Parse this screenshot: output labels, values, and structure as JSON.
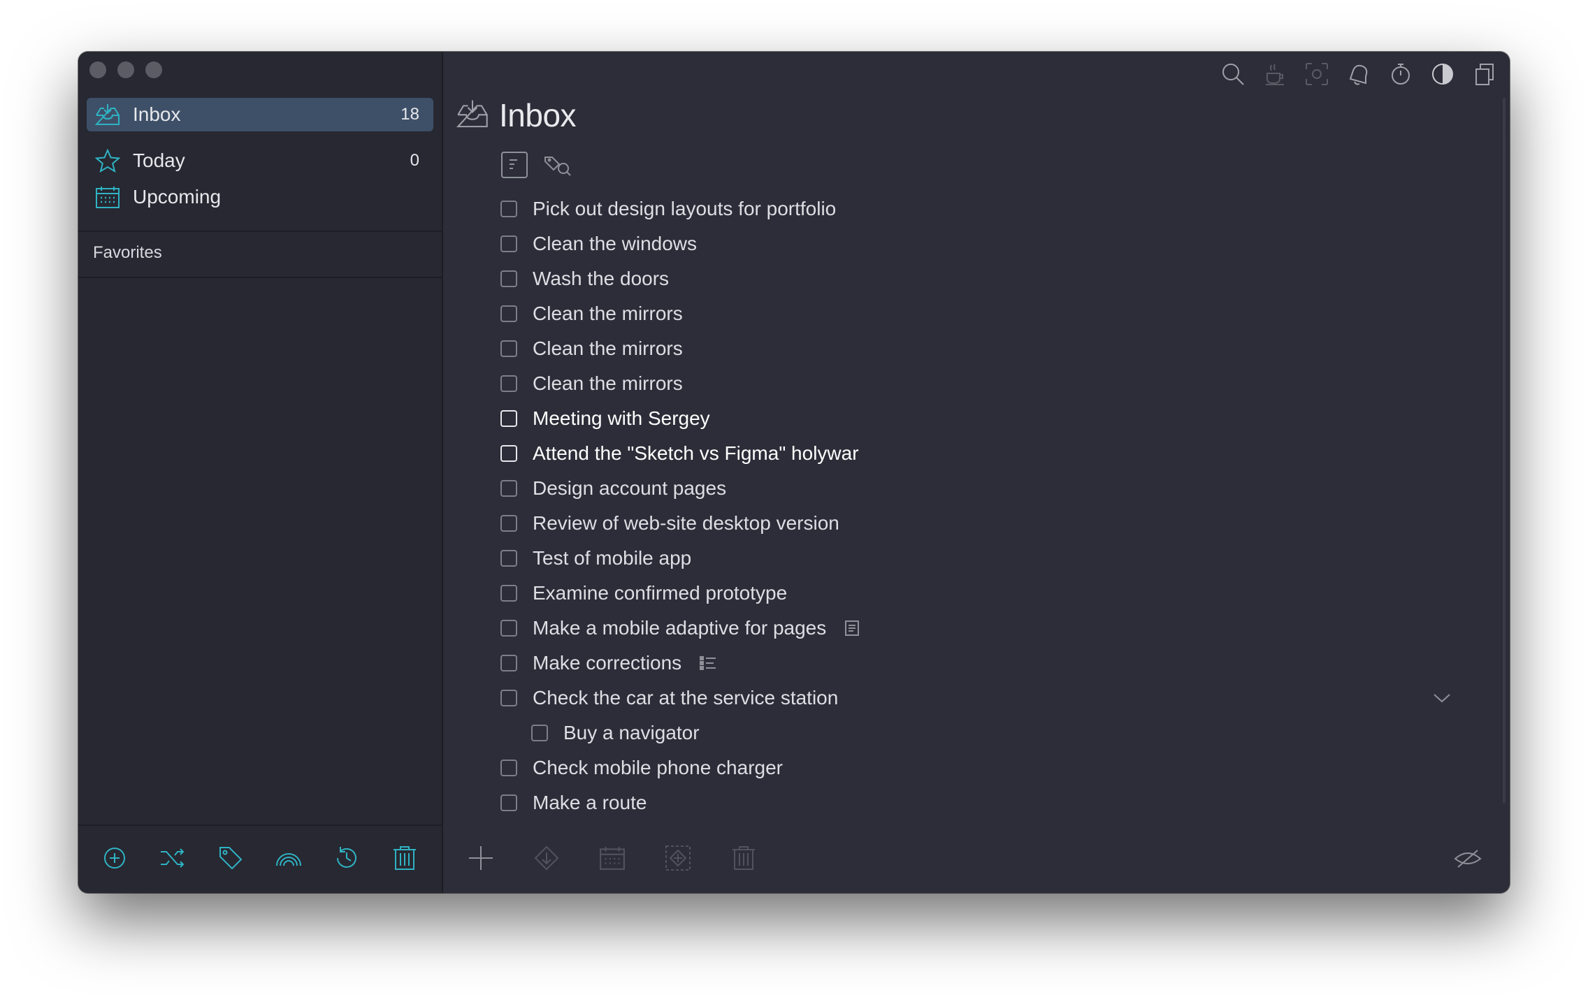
{
  "colors": {
    "accent": "#2fb3c4",
    "sidebar": "#272831",
    "main": "#2c2d38",
    "active": "#3e5068"
  },
  "sidebar": {
    "items": [
      {
        "label": "Inbox",
        "count": "18",
        "icon": "inbox-icon"
      },
      {
        "label": "Today",
        "count": "0",
        "icon": "star-icon"
      },
      {
        "label": "Upcoming",
        "count": "",
        "icon": "calendar-icon"
      }
    ],
    "favorites_label": "Favorites",
    "bottom_icons": [
      "add-circle-icon",
      "shuffle-icon",
      "tag-icon",
      "rainbow-icon",
      "history-icon",
      "trash-icon"
    ]
  },
  "header": {
    "title": "Inbox",
    "toolbar_icons": [
      "search-icon",
      "coffee-icon",
      "focus-icon",
      "bell-icon",
      "timer-icon",
      "contrast-icon",
      "copy-icon"
    ]
  },
  "tasks": [
    {
      "label": "Pick out design layouts for portfolio"
    },
    {
      "label": "Clean the windows"
    },
    {
      "label": "Wash the doors"
    },
    {
      "label": "Clean the mirrors"
    },
    {
      "label": "Clean the mirrors"
    },
    {
      "label": "Clean the mirrors"
    },
    {
      "label": "Meeting with Sergey",
      "bold": true
    },
    {
      "label": "Attend the \"Sketch vs Figma\" holywar",
      "bold": true
    },
    {
      "label": "Design account pages"
    },
    {
      "label": "Review of web-site desktop version"
    },
    {
      "label": "Test of mobile app"
    },
    {
      "label": "Examine confirmed prototype"
    },
    {
      "label": "Make a mobile adaptive for pages",
      "extra": "note-icon"
    },
    {
      "label": "Make corrections",
      "extra": "checklist-icon"
    },
    {
      "label": "Check the car at the service station",
      "expandable": true
    },
    {
      "label": "Buy a navigator",
      "sub": true
    },
    {
      "label": "Check mobile phone charger"
    },
    {
      "label": "Make a route"
    }
  ],
  "footer_icons": [
    "add-icon",
    "move-icon",
    "schedule-icon",
    "focus-select-icon",
    "delete-icon",
    "hide-completed-icon"
  ]
}
